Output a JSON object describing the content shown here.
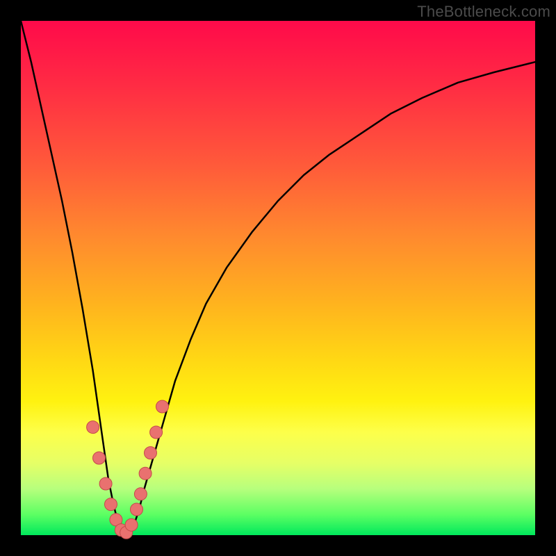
{
  "watermark": "TheBottleneck.com",
  "colors": {
    "frame": "#000000",
    "curve": "#000000",
    "marker_fill": "#e9716f",
    "marker_stroke": "#c34a4a"
  },
  "chart_data": {
    "type": "line",
    "title": "",
    "xlabel": "",
    "ylabel": "",
    "xlim": [
      0,
      100
    ],
    "ylim": [
      0,
      100
    ],
    "grid": false,
    "legend": false,
    "annotations": [
      "TheBottleneck.com"
    ],
    "series": [
      {
        "name": "bottleneck-curve",
        "x": [
          0,
          2,
          4,
          6,
          8,
          10,
          12,
          13,
          14,
          15,
          16,
          17,
          18,
          19,
          20,
          21,
          22,
          23,
          24,
          26,
          28,
          30,
          33,
          36,
          40,
          45,
          50,
          55,
          60,
          66,
          72,
          78,
          85,
          92,
          100
        ],
        "y": [
          100,
          92,
          83,
          74,
          65,
          55,
          44,
          38,
          32,
          25,
          18,
          11,
          6,
          2,
          0,
          0,
          2,
          5,
          9,
          16,
          23,
          30,
          38,
          45,
          52,
          59,
          65,
          70,
          74,
          78,
          82,
          85,
          88,
          90,
          92
        ]
      }
    ],
    "markers": [
      {
        "x": 14.0,
        "y": 21.0
      },
      {
        "x": 15.2,
        "y": 15.0
      },
      {
        "x": 16.5,
        "y": 10.0
      },
      {
        "x": 17.5,
        "y": 6.0
      },
      {
        "x": 18.5,
        "y": 3.0
      },
      {
        "x": 19.5,
        "y": 1.0
      },
      {
        "x": 20.5,
        "y": 0.5
      },
      {
        "x": 21.5,
        "y": 2.0
      },
      {
        "x": 22.5,
        "y": 5.0
      },
      {
        "x": 23.3,
        "y": 8.0
      },
      {
        "x": 24.2,
        "y": 12.0
      },
      {
        "x": 25.2,
        "y": 16.0
      },
      {
        "x": 26.3,
        "y": 20.0
      },
      {
        "x": 27.5,
        "y": 25.0
      }
    ],
    "notes": "Axes are unlabeled; values are normalized 0-100. Curve minimum occurs near x≈20. Right branch asymptotically approaches ~92."
  }
}
